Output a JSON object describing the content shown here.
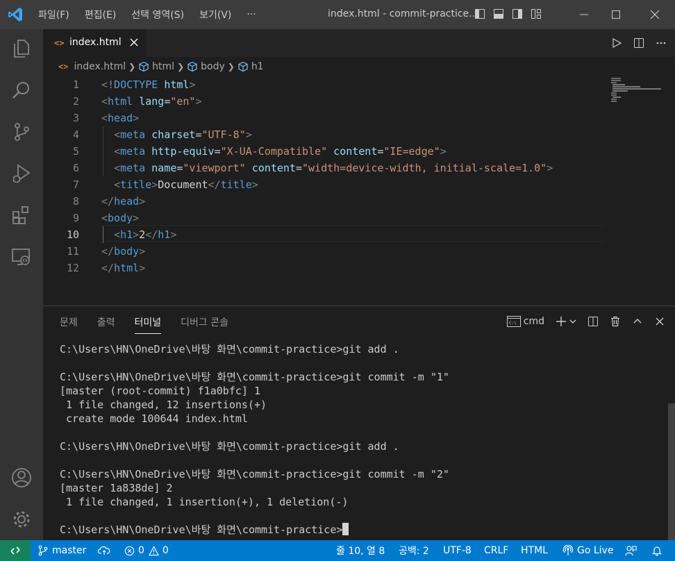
{
  "menu": {
    "items": [
      "파일(F)",
      "편집(E)",
      "선택 영역(S)",
      "보기(V)"
    ],
    "more": "···"
  },
  "window": {
    "title": "index.html - commit-practice..."
  },
  "tab": {
    "label": "index.html",
    "file_icon": "<>"
  },
  "breadcrumbs": {
    "file": "index.html",
    "items": [
      "html",
      "body",
      "h1"
    ]
  },
  "editor": {
    "active_line": 10,
    "lines": [
      {
        "n": "1",
        "tokens": [
          [
            "bracket",
            "<"
          ],
          [
            "tag",
            "!DOCTYPE"
          ],
          [
            "txt",
            " "
          ],
          [
            "attr",
            "html"
          ],
          [
            "bracket",
            ">"
          ]
        ]
      },
      {
        "n": "2",
        "tokens": [
          [
            "bracket",
            "<"
          ],
          [
            "tag",
            "html"
          ],
          [
            "txt",
            " "
          ],
          [
            "attr",
            "lang"
          ],
          [
            "txt",
            "="
          ],
          [
            "str",
            "\"en\""
          ],
          [
            "bracket",
            ">"
          ]
        ]
      },
      {
        "n": "3",
        "tokens": [
          [
            "bracket",
            "<"
          ],
          [
            "tag",
            "head"
          ],
          [
            "bracket",
            ">"
          ]
        ]
      },
      {
        "n": "4",
        "tokens": [
          [
            "txt",
            "  "
          ],
          [
            "bracket",
            "<"
          ],
          [
            "tag",
            "meta"
          ],
          [
            "txt",
            " "
          ],
          [
            "attr",
            "charset"
          ],
          [
            "txt",
            "="
          ],
          [
            "str",
            "\"UTF-8\""
          ],
          [
            "bracket",
            ">"
          ]
        ]
      },
      {
        "n": "5",
        "tokens": [
          [
            "txt",
            "  "
          ],
          [
            "bracket",
            "<"
          ],
          [
            "tag",
            "meta"
          ],
          [
            "txt",
            " "
          ],
          [
            "attr",
            "http-equiv"
          ],
          [
            "txt",
            "="
          ],
          [
            "str",
            "\"X-UA-Compatible\""
          ],
          [
            "txt",
            " "
          ],
          [
            "attr",
            "content"
          ],
          [
            "txt",
            "="
          ],
          [
            "str",
            "\"IE=edge\""
          ],
          [
            "bracket",
            ">"
          ]
        ]
      },
      {
        "n": "6",
        "tokens": [
          [
            "txt",
            "  "
          ],
          [
            "bracket",
            "<"
          ],
          [
            "tag",
            "meta"
          ],
          [
            "txt",
            " "
          ],
          [
            "attr",
            "name"
          ],
          [
            "txt",
            "="
          ],
          [
            "str",
            "\"viewport\""
          ],
          [
            "txt",
            " "
          ],
          [
            "attr",
            "content"
          ],
          [
            "txt",
            "="
          ],
          [
            "str",
            "\"width=device-width, initial-scale=1.0\""
          ],
          [
            "bracket",
            ">"
          ]
        ]
      },
      {
        "n": "7",
        "tokens": [
          [
            "txt",
            "  "
          ],
          [
            "bracket",
            "<"
          ],
          [
            "tag",
            "title"
          ],
          [
            "bracket",
            ">"
          ],
          [
            "txt",
            "Document"
          ],
          [
            "bracket",
            "</"
          ],
          [
            "tag",
            "title"
          ],
          [
            "bracket",
            ">"
          ]
        ]
      },
      {
        "n": "8",
        "tokens": [
          [
            "bracket",
            "</"
          ],
          [
            "tag",
            "head"
          ],
          [
            "bracket",
            ">"
          ]
        ]
      },
      {
        "n": "9",
        "tokens": [
          [
            "bracket",
            "<"
          ],
          [
            "tag",
            "body"
          ],
          [
            "bracket",
            ">"
          ]
        ]
      },
      {
        "n": "10",
        "tokens": [
          [
            "txt",
            "  "
          ],
          [
            "bracket",
            "<"
          ],
          [
            "tag",
            "h1"
          ],
          [
            "bracket",
            ">"
          ],
          [
            "txt",
            "2"
          ],
          [
            "bracket",
            "</"
          ],
          [
            "tag",
            "h1"
          ],
          [
            "bracket",
            ">"
          ]
        ]
      },
      {
        "n": "11",
        "tokens": [
          [
            "bracket",
            "</"
          ],
          [
            "tag",
            "body"
          ],
          [
            "bracket",
            ">"
          ]
        ]
      },
      {
        "n": "12",
        "tokens": [
          [
            "bracket",
            "</"
          ],
          [
            "tag",
            "html"
          ],
          [
            "bracket",
            ">"
          ]
        ]
      }
    ]
  },
  "panel": {
    "tabs": [
      "문제",
      "출력",
      "터미널",
      "디버그 콘솔"
    ],
    "active_tab": "터미널",
    "shell": "cmd",
    "terminal_lines": [
      "C:\\Users\\HN\\OneDrive\\바탕 화면\\commit-practice>git add .",
      "",
      "C:\\Users\\HN\\OneDrive\\바탕 화면\\commit-practice>git commit -m \"1\"",
      "[master (root-commit) f1a0bfc] 1",
      " 1 file changed, 12 insertions(+)",
      " create mode 100644 index.html",
      "",
      "C:\\Users\\HN\\OneDrive\\바탕 화면\\commit-practice>git add .",
      "",
      "C:\\Users\\HN\\OneDrive\\바탕 화면\\commit-practice>git commit -m \"2\"",
      "[master 1a838de] 2",
      " 1 file changed, 1 insertion(+), 1 deletion(-)",
      "",
      "C:\\Users\\HN\\OneDrive\\바탕 화면\\commit-practice>"
    ]
  },
  "status": {
    "branch": "master",
    "errors": "0",
    "warnings": "0",
    "position": "줄 10, 열 8",
    "indent": "공백: 2",
    "encoding": "UTF-8",
    "eol": "CRLF",
    "language": "HTML",
    "golive": "Go Live"
  },
  "colors": {
    "statusbar": "#007acc",
    "remote": "#16825d",
    "tag": "#569cd6",
    "attribute": "#9cdcfe",
    "string": "#ce9178"
  }
}
